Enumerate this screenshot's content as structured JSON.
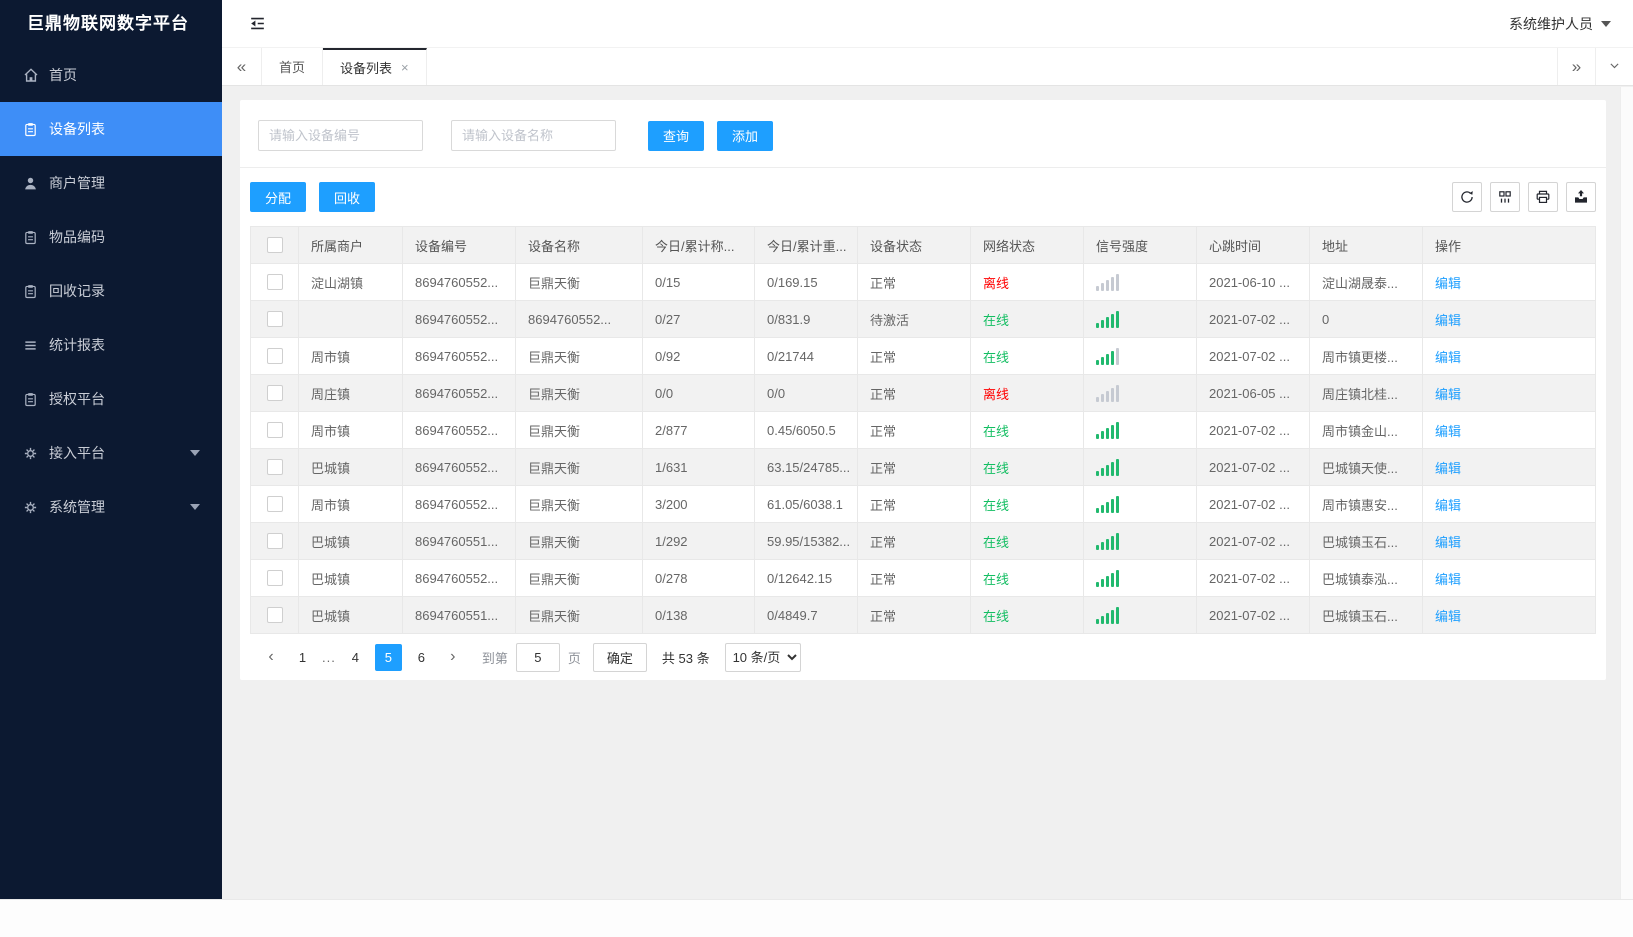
{
  "app": {
    "title": "巨鼎物联网数字平台",
    "user": "系统维护人员"
  },
  "colors": {
    "accent": "#1E9FFF",
    "sidebar_bg": "#0C1931",
    "sidebar_active": "#3E8EF7",
    "online_green": "#13BE62",
    "offline_red": "#FF0000",
    "signal_green": "#21B96E",
    "signal_gray": "#C6CAD2"
  },
  "sidebar": {
    "items": [
      {
        "label": "首页",
        "icon": "home-icon",
        "active": false,
        "arrow": false
      },
      {
        "label": "设备列表",
        "icon": "device-list-icon",
        "active": true,
        "arrow": false
      },
      {
        "label": "商户管理",
        "icon": "merchant-icon",
        "active": false,
        "arrow": false
      },
      {
        "label": "物品编码",
        "icon": "item-code-icon",
        "active": false,
        "arrow": false
      },
      {
        "label": "回收记录",
        "icon": "recycle-record-icon",
        "active": false,
        "arrow": false
      },
      {
        "label": "统计报表",
        "icon": "report-icon",
        "active": false,
        "arrow": false
      },
      {
        "label": "授权平台",
        "icon": "auth-platform-icon",
        "active": false,
        "arrow": false
      },
      {
        "label": "接入平台",
        "icon": "access-platform-icon",
        "active": false,
        "arrow": true
      },
      {
        "label": "系统管理",
        "icon": "system-manage-icon",
        "active": false,
        "arrow": true
      }
    ]
  },
  "tabs": {
    "scroll_left": "«",
    "scroll_right": "»",
    "items": [
      {
        "label": "首页",
        "active": false,
        "closable": false
      },
      {
        "label": "设备列表",
        "active": true,
        "closable": true,
        "close_glyph": "×"
      }
    ]
  },
  "search": {
    "device_no_placeholder": "请输入设备编号",
    "device_name_placeholder": "请输入设备名称",
    "query_label": "查询",
    "add_label": "添加"
  },
  "toolbar": {
    "assign_label": "分配",
    "recycle_label": "回收",
    "icons": [
      "refresh-icon",
      "columns-icon",
      "print-icon",
      "export-icon"
    ]
  },
  "table": {
    "columns": [
      "所属商户",
      "设备编号",
      "设备名称",
      "今日/累计称...",
      "今日/累计重...",
      "设备状态",
      "网络状态",
      "信号强度",
      "心跳时间",
      "地址",
      "操作"
    ],
    "rows": [
      {
        "merchant": "淀山湖镇",
        "device_no": "8694760552...",
        "device_name": "巨鼎天衡",
        "today_count": "0/15",
        "today_weight": "0/169.15",
        "device_status": "正常",
        "network_status": "离线",
        "network_online": false,
        "signal": 0,
        "heartbeat": "2021-06-10 ...",
        "address": "淀山湖晟泰...",
        "action": "编辑"
      },
      {
        "merchant": "",
        "device_no": "8694760552...",
        "device_name": "8694760552...",
        "today_count": "0/27",
        "today_weight": "0/831.9",
        "device_status": "待激活",
        "network_status": "在线",
        "network_online": true,
        "signal": 5,
        "heartbeat": "2021-07-02 ...",
        "address": "0",
        "action": "编辑"
      },
      {
        "merchant": "周市镇",
        "device_no": "8694760552...",
        "device_name": "巨鼎天衡",
        "today_count": "0/92",
        "today_weight": "0/21744",
        "device_status": "正常",
        "network_status": "在线",
        "network_online": true,
        "signal": 4,
        "heartbeat": "2021-07-02 ...",
        "address": "周市镇更楼...",
        "action": "编辑"
      },
      {
        "merchant": "周庄镇",
        "device_no": "8694760552...",
        "device_name": "巨鼎天衡",
        "today_count": "0/0",
        "today_weight": "0/0",
        "device_status": "正常",
        "network_status": "离线",
        "network_online": false,
        "signal": 0,
        "heartbeat": "2021-06-05 ...",
        "address": "周庄镇北桂...",
        "action": "编辑"
      },
      {
        "merchant": "周市镇",
        "device_no": "8694760552...",
        "device_name": "巨鼎天衡",
        "today_count": "2/877",
        "today_weight": "0.45/6050.5",
        "device_status": "正常",
        "network_status": "在线",
        "network_online": true,
        "signal": 5,
        "heartbeat": "2021-07-02 ...",
        "address": "周市镇金山...",
        "action": "编辑"
      },
      {
        "merchant": "巴城镇",
        "device_no": "8694760552...",
        "device_name": "巨鼎天衡",
        "today_count": "1/631",
        "today_weight": "63.15/24785...",
        "device_status": "正常",
        "network_status": "在线",
        "network_online": true,
        "signal": 5,
        "heartbeat": "2021-07-02 ...",
        "address": "巴城镇天使...",
        "action": "编辑"
      },
      {
        "merchant": "周市镇",
        "device_no": "8694760552...",
        "device_name": "巨鼎天衡",
        "today_count": "3/200",
        "today_weight": "61.05/6038.1",
        "device_status": "正常",
        "network_status": "在线",
        "network_online": true,
        "signal": 5,
        "heartbeat": "2021-07-02 ...",
        "address": "周市镇惠安...",
        "action": "编辑"
      },
      {
        "merchant": "巴城镇",
        "device_no": "8694760551...",
        "device_name": "巨鼎天衡",
        "today_count": "1/292",
        "today_weight": "59.95/15382...",
        "device_status": "正常",
        "network_status": "在线",
        "network_online": true,
        "signal": 5,
        "heartbeat": "2021-07-02 ...",
        "address": "巴城镇玉石...",
        "action": "编辑"
      },
      {
        "merchant": "巴城镇",
        "device_no": "8694760552...",
        "device_name": "巨鼎天衡",
        "today_count": "0/278",
        "today_weight": "0/12642.15",
        "device_status": "正常",
        "network_status": "在线",
        "network_online": true,
        "signal": 5,
        "heartbeat": "2021-07-02 ...",
        "address": "巴城镇泰泓...",
        "action": "编辑"
      },
      {
        "merchant": "巴城镇",
        "device_no": "8694760551...",
        "device_name": "巨鼎天衡",
        "today_count": "0/138",
        "today_weight": "0/4849.7",
        "device_status": "正常",
        "network_status": "在线",
        "network_online": true,
        "signal": 5,
        "heartbeat": "2021-07-02 ...",
        "address": "巴城镇玉石...",
        "action": "编辑"
      }
    ]
  },
  "pagination": {
    "prev_glyph": "‹",
    "next_glyph": "›",
    "pages": [
      "1",
      "...",
      "4",
      "5",
      "6"
    ],
    "active_page": "5",
    "goto_label": "到第",
    "goto_value": "5",
    "goto_unit": "页",
    "confirm_label": "确定",
    "total_text": "共 53 条",
    "page_size_option": "10 条/页"
  }
}
